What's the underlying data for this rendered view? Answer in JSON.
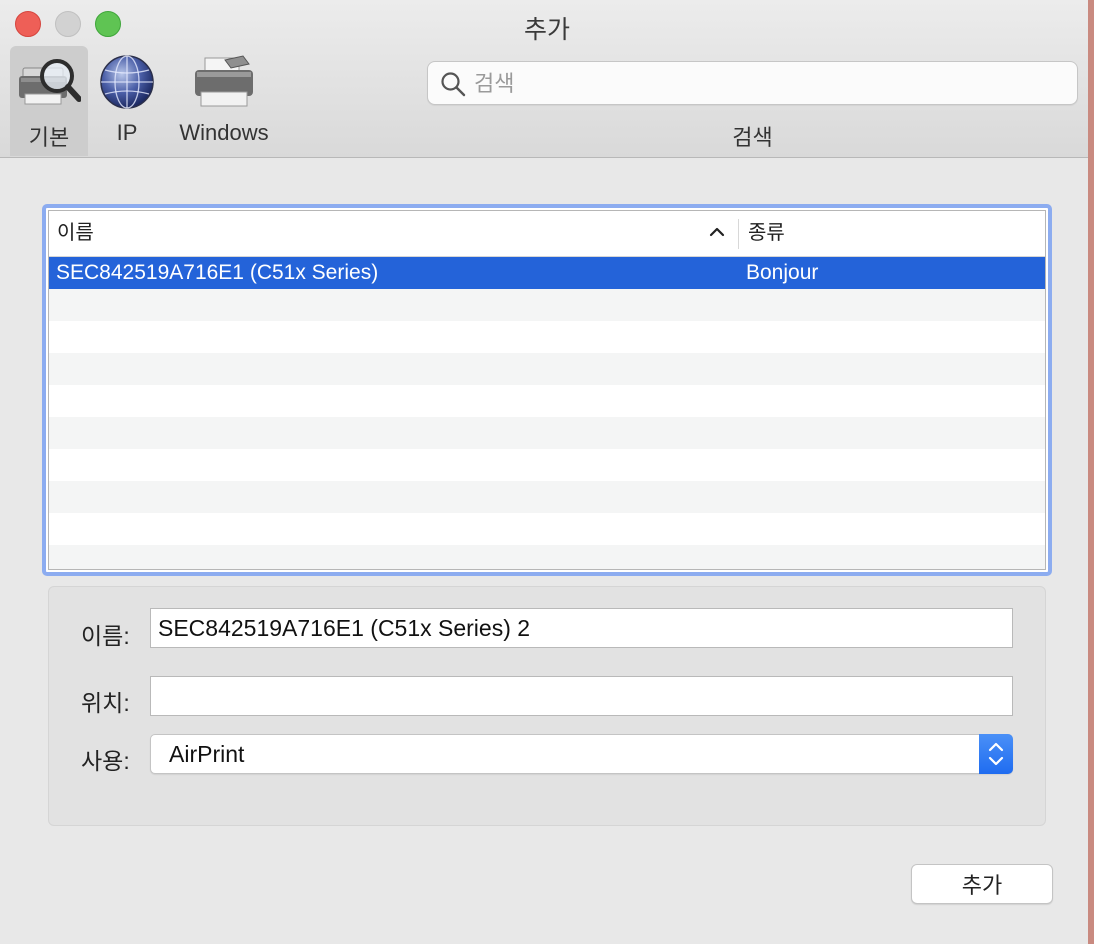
{
  "window": {
    "title": "추가"
  },
  "toolbar": {
    "items": [
      {
        "label": "기본",
        "icon": "printer-magnifier-icon"
      },
      {
        "label": "IP",
        "icon": "globe-icon"
      },
      {
        "label": "Windows",
        "icon": "printer-icon"
      }
    ],
    "search": {
      "placeholder": "검색",
      "value": "",
      "caption": "검색"
    }
  },
  "printer_list": {
    "columns": {
      "name": "이름",
      "kind": "종류"
    },
    "sort": "ascending",
    "rows": [
      {
        "name": "SEC842519A716E1 (C51x Series)",
        "kind": "Bonjour",
        "selected": true
      }
    ]
  },
  "details": {
    "name_label": "이름:",
    "name_value": "SEC842519A716E1 (C51x Series) 2",
    "location_label": "위치:",
    "location_value": "",
    "use_label": "사용:",
    "use_value": "AirPrint"
  },
  "buttons": {
    "add": "추가"
  },
  "colors": {
    "selection": "#2463d9",
    "focus_ring": "#8cacf0",
    "accent": "#1f6cf0"
  }
}
